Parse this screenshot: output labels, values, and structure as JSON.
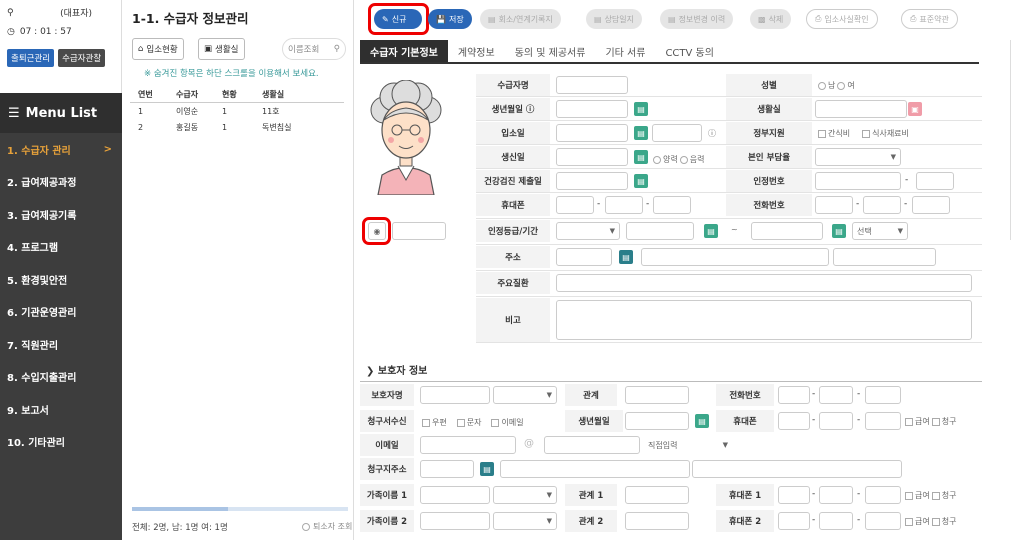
{
  "user": {
    "role": "(대표자)",
    "time": "07 : 01 : 57"
  },
  "side_buttons": {
    "attend": "출퇴근관리",
    "observe": "수급자관찰"
  },
  "menu": {
    "title": "Menu List",
    "items": [
      "1. 수급자 관리",
      "2. 급여제공과정",
      "3. 급여제공기록",
      "4. 프로그램",
      "5. 환경및안전",
      "6. 기관운영관리",
      "7. 직원관리",
      "8. 수입지출관리",
      "9. 보고서",
      "10. 기타관리"
    ],
    "active_marker": ">"
  },
  "list": {
    "title": "1-1. 수급자 정보관리",
    "btn_status": "입소현황",
    "btn_room": "생활실",
    "btn_search": "이름조회",
    "hint": "※ 숨겨진 항목은 하단 스크롤을 이용해서 보세요.",
    "headers": [
      "연번",
      "수급자",
      "현황",
      "생활실"
    ],
    "rows": [
      [
        "1",
        "이영순",
        "1",
        "11호"
      ],
      [
        "2",
        "홍길동",
        "1",
        "독변침실"
      ]
    ],
    "footer": "전체: 2명, 남: 1명 여: 1명",
    "retire": "퇴소자 조회"
  },
  "toolbar": {
    "new": "신규",
    "save": "저장",
    "b3": "회소/연계기록지",
    "b4": "상담일지",
    "b5": "정보변경 이력",
    "b6": "삭제",
    "b7": "입소사실확인",
    "b8": "표준약관"
  },
  "tabs": [
    "수급자 기본정보",
    "계약정보",
    "동의 및 제공서류",
    "기타 서류",
    "CCTV 동의"
  ],
  "form": {
    "name": "수급자명",
    "gender": "성별",
    "male": "남",
    "female": "여",
    "birth": "생년월일 ⓘ",
    "room": "생활실",
    "admit": "입소일",
    "gov": "정부지원",
    "snack": "간식비",
    "meal": "식사재료비",
    "birthday": "생신일",
    "lunar": "양력",
    "solar": "음력",
    "burden": "본인 부담율",
    "health": "건강검진 제출일",
    "cert": "인정번호",
    "mobile": "휴대폰",
    "phone": "전화번호",
    "grade": "인정등급/기간",
    "select": "선택",
    "tilde": "~",
    "addr": "주소",
    "disease": "주요질환",
    "note": "비고"
  },
  "guardian": {
    "title": "보호자 정보",
    "name": "보호자명",
    "rel": "관계",
    "phone": "전화번호",
    "billing": "청구서수신",
    "post": "우편",
    "sms": "문자",
    "email_chk": "이메일",
    "birth": "생년월일",
    "mobile": "휴대폰",
    "pay": "급여",
    "claim": "청구",
    "email": "이메일",
    "at": "@",
    "direct": "직접입력",
    "baddr": "청구지주소",
    "fam1": "가족이름 1",
    "rel1": "관계 1",
    "mob1": "휴대폰 1",
    "fam2": "가족이름 2",
    "rel2": "관계 2",
    "mob2": "휴대폰 2"
  }
}
